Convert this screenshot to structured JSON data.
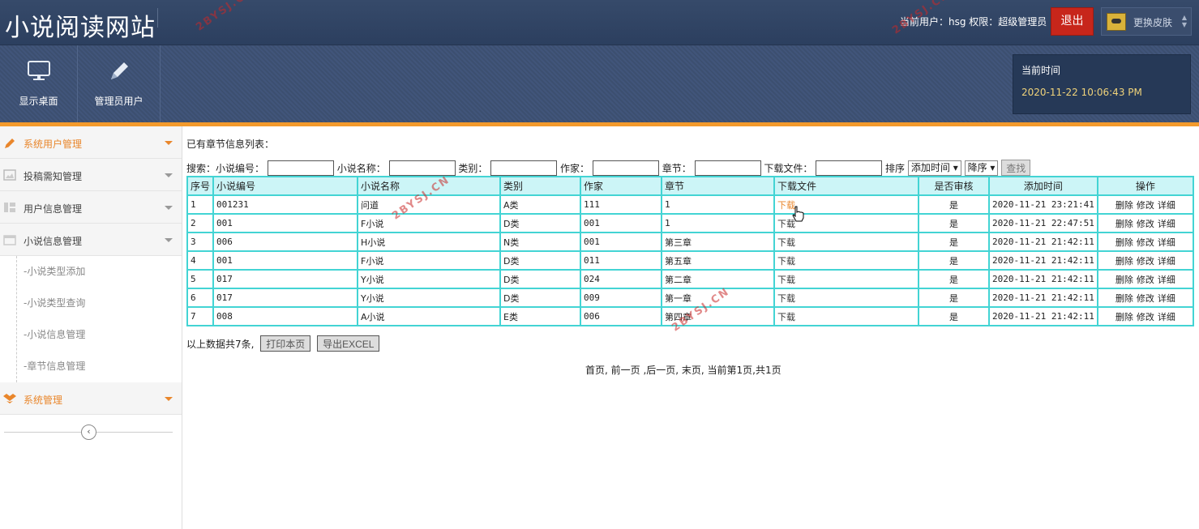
{
  "header": {
    "site_title": "小说阅读网站",
    "user_info": "当前用户：hsg  权限：超级管理员",
    "logout_label": "退出",
    "skin_label": "更换皮肤"
  },
  "nav": {
    "buttons": [
      {
        "label": "显示桌面",
        "icon": "monitor-icon"
      },
      {
        "label": "管理员用户",
        "icon": "pencil-icon"
      }
    ],
    "time_title": "当前时间",
    "time_value": "2020-11-22 10:06:43 PM"
  },
  "sidebar": {
    "items": [
      {
        "label": "系统用户管理",
        "icon": "pencil-icon",
        "active": true
      },
      {
        "label": "投稿需知管理",
        "icon": "image-icon"
      },
      {
        "label": "用户信息管理",
        "icon": "layout-icon"
      },
      {
        "label": "小说信息管理",
        "icon": "calendar-icon"
      }
    ],
    "sub_items": [
      "-小说类型添加",
      "-小说类型查询",
      "-小说信息管理",
      "-章节信息管理"
    ],
    "system_item": {
      "label": "系统管理",
      "icon": "dropbox-icon"
    },
    "collapse_icon": "chevron-left-icon"
  },
  "content": {
    "list_title": "已有章节信息列表：",
    "search": {
      "prefix": "搜索：",
      "labels": [
        "小说编号：",
        "小说名称：",
        "类别：",
        "作家：",
        "章节：",
        "下载文件："
      ],
      "sort_label": "排序",
      "sort_field": "添加时间",
      "sort_order": "降序",
      "search_button": "查找"
    },
    "table": {
      "columns": [
        "序号",
        "小说编号",
        "小说名称",
        "类别",
        "作家",
        "章节",
        "下载文件",
        "是否审核",
        "添加时间",
        "操作"
      ],
      "rows": [
        {
          "no": "1",
          "code": "001231",
          "name": "问道",
          "category": "A类",
          "author": "111",
          "chapter": "1",
          "file": "下载",
          "audited": "是",
          "time": "2020-11-21 23:21:41"
        },
        {
          "no": "2",
          "code": "001",
          "name": "F小说",
          "category": "D类",
          "author": "001",
          "chapter": "1",
          "file": "下载",
          "audited": "是",
          "time": "2020-11-21 22:47:51"
        },
        {
          "no": "3",
          "code": "006",
          "name": "H小说",
          "category": "N类",
          "author": "001",
          "chapter": "第三章",
          "file": "下载",
          "audited": "是",
          "time": "2020-11-21 21:42:11"
        },
        {
          "no": "4",
          "code": "001",
          "name": "F小说",
          "category": "D类",
          "author": "011",
          "chapter": "第五章",
          "file": "下载",
          "audited": "是",
          "time": "2020-11-21 21:42:11"
        },
        {
          "no": "5",
          "code": "017",
          "name": "Y小说",
          "category": "D类",
          "author": "024",
          "chapter": "第二章",
          "file": "下载",
          "audited": "是",
          "time": "2020-11-21 21:42:11"
        },
        {
          "no": "6",
          "code": "017",
          "name": "Y小说",
          "category": "D类",
          "author": "009",
          "chapter": "第一章",
          "file": "下载",
          "audited": "是",
          "time": "2020-11-21 21:42:11"
        },
        {
          "no": "7",
          "code": "008",
          "name": "A小说",
          "category": "E类",
          "author": "006",
          "chapter": "第四章",
          "file": "下载",
          "audited": "是",
          "time": "2020-11-21 21:42:11"
        }
      ],
      "ops": [
        "删除",
        "修改",
        "详细"
      ]
    },
    "footer": {
      "total_text": "以上数据共7条,",
      "print_button": "打印本页",
      "export_button": "导出EXCEL"
    },
    "pager": "首页, 前一页 ,后一页, 末页, 当前第1页,共1页"
  },
  "watermark": "2BYSJ.CN",
  "colors": {
    "accent": "#f39a2c",
    "header": "#2c3f5f",
    "table_border": "#43d4d4",
    "logout": "#c7261b"
  }
}
